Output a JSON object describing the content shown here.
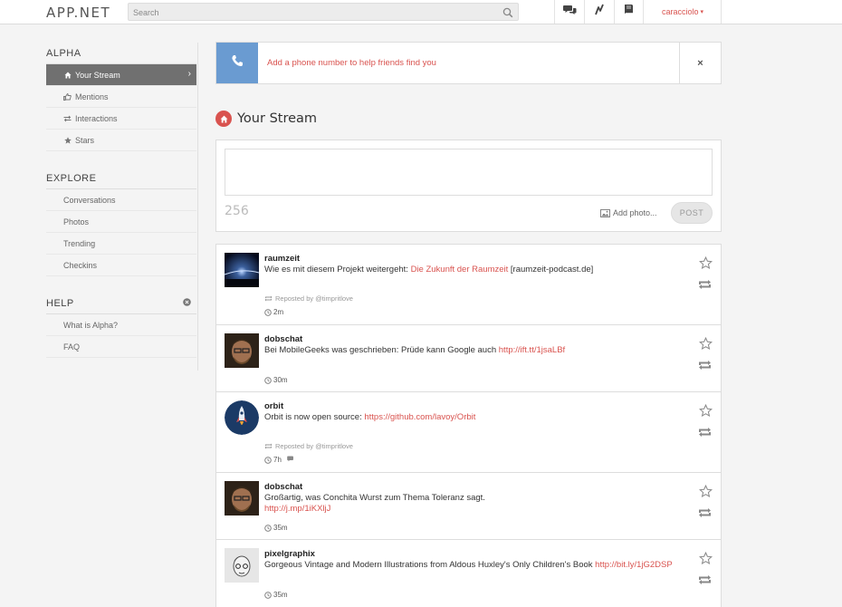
{
  "header": {
    "logo": "APP.NET",
    "search_placeholder": "Search",
    "username": "caracciolo"
  },
  "sidebar": {
    "alpha": {
      "title": "ALPHA",
      "items": [
        {
          "label": "Your Stream",
          "icon": "home-icon",
          "active": true
        },
        {
          "label": "Mentions",
          "icon": "thumbs-up-icon"
        },
        {
          "label": "Interactions",
          "icon": "arrows-icon"
        },
        {
          "label": "Stars",
          "icon": "star-icon"
        }
      ]
    },
    "explore": {
      "title": "EXPLORE",
      "items": [
        {
          "label": "Conversations"
        },
        {
          "label": "Photos"
        },
        {
          "label": "Trending"
        },
        {
          "label": "Checkins"
        }
      ]
    },
    "help": {
      "title": "HELP",
      "items": [
        {
          "label": "What is Alpha?"
        },
        {
          "label": "FAQ"
        }
      ]
    }
  },
  "notice": {
    "text": "Add a phone number to help friends find you",
    "close": "×"
  },
  "stream": {
    "title": "Your Stream"
  },
  "composer": {
    "char_count": "256",
    "add_photo": "Add photo...",
    "post": "POST"
  },
  "posts": [
    {
      "user": "raumzeit",
      "text": "Wie es mit diesem Projekt weitergeht: ",
      "link": "Die Zukunft der Raumzeit",
      "text_after": " [raumzeit-podcast.de]",
      "repost": "Reposted by @timpritlove",
      "time": "2m"
    },
    {
      "user": "dobschat",
      "text": "Bei MobileGeeks was geschrieben: Prüde kann Google auch ",
      "link": "http://ift.tt/1jsaLBf",
      "text_after": "",
      "repost": "",
      "time": "30m"
    },
    {
      "user": "orbit",
      "text": "Orbit is now open source: ",
      "link": "https://github.com/lavoy/Orbit",
      "text_after": "",
      "repost": "Reposted by @timpritlove",
      "time": "7h"
    },
    {
      "user": "dobschat",
      "text": "Großartig, was Conchita Wurst zum Thema Toleranz sagt.",
      "link": "http://j.mp/1iKXljJ",
      "text_after": "",
      "repost": "",
      "time": "35m"
    },
    {
      "user": "pixelgraphix",
      "text": "Gorgeous Vintage and Modern Illustrations from Aldous Huxley's Only Children's Book ",
      "link": "http://bit.ly/1jG2DSP",
      "text_after": "",
      "repost": "",
      "time": "35m"
    }
  ],
  "colors": {
    "accent": "#d9534f",
    "phone_blue": "#6a9bd1",
    "active_nav": "#707070"
  }
}
